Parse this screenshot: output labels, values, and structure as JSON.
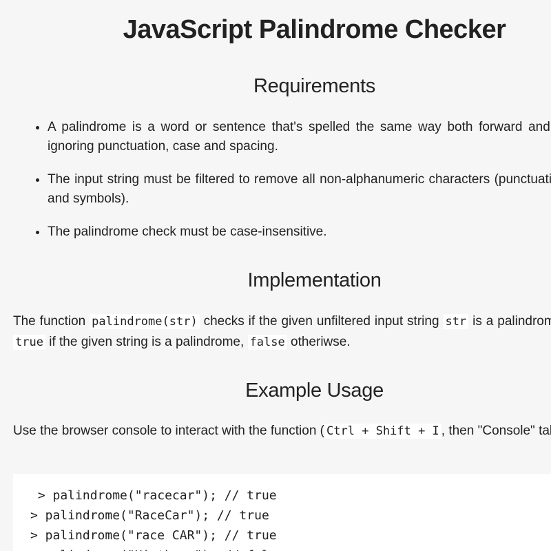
{
  "title": "JavaScript Palindrome Checker",
  "requirements": {
    "heading": "Requirements",
    "items": [
      "A palindrome is a word or sentence that's spelled the same way both forward and backward, ignoring punctuation, case and spacing.",
      "The input string must be filtered to remove all non-alphanumeric characters (punctuation, spaces and symbols).",
      "The palindrome check must be case-insensitive."
    ]
  },
  "implementation": {
    "heading": "Implementation",
    "text_1": "The function ",
    "code_fn": "palindrome(str)",
    "text_2": " checks if the given unfiltered input string ",
    "code_str": "str",
    "text_3": " is a palindrome. Returns ",
    "code_true": "true",
    "text_4": " if the given string is a palindrome, ",
    "code_false": "false",
    "text_5": " otheriwse."
  },
  "example": {
    "heading": "Example Usage",
    "text_1": "Use the browser console to interact with the function (",
    "shortcut": "Ctrl + Shift + I",
    "text_2": ", then \"Console\" tab):",
    "code_lines": [
      " > palindrome(\"racecar\"); // true",
      "> palindrome(\"RaceCar\"); // true",
      "> palindrome(\"race CAR\"); // true",
      "> palindrome(\"Hi there\"); // false"
    ]
  }
}
